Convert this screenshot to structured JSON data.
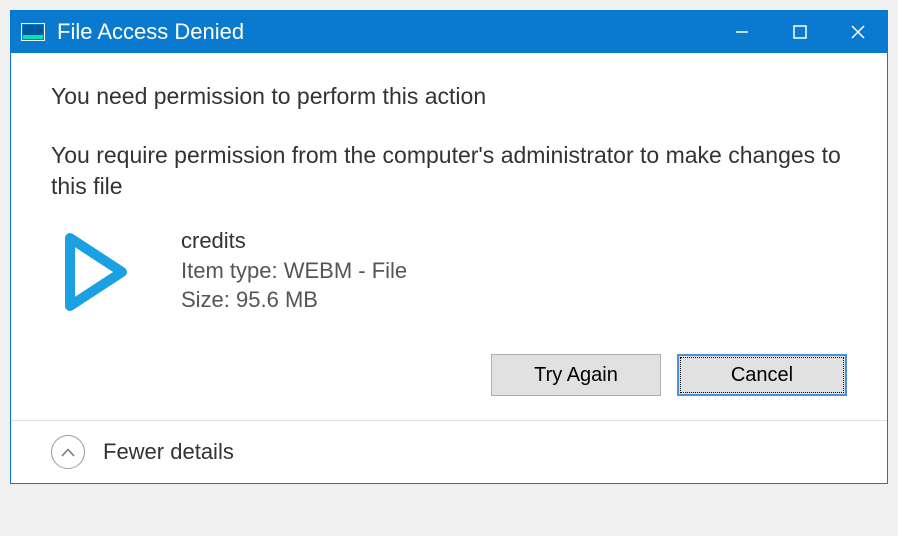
{
  "titlebar": {
    "title": "File Access Denied"
  },
  "content": {
    "heading": "You need permission to perform this action",
    "description": "You require permission from the computer's administrator to make changes to this file",
    "file": {
      "name": "credits",
      "type": "Item type: WEBM - File",
      "size": "Size: 95.6 MB"
    }
  },
  "buttons": {
    "try_again": "Try Again",
    "cancel": "Cancel"
  },
  "footer": {
    "fewer_details": "Fewer details"
  }
}
